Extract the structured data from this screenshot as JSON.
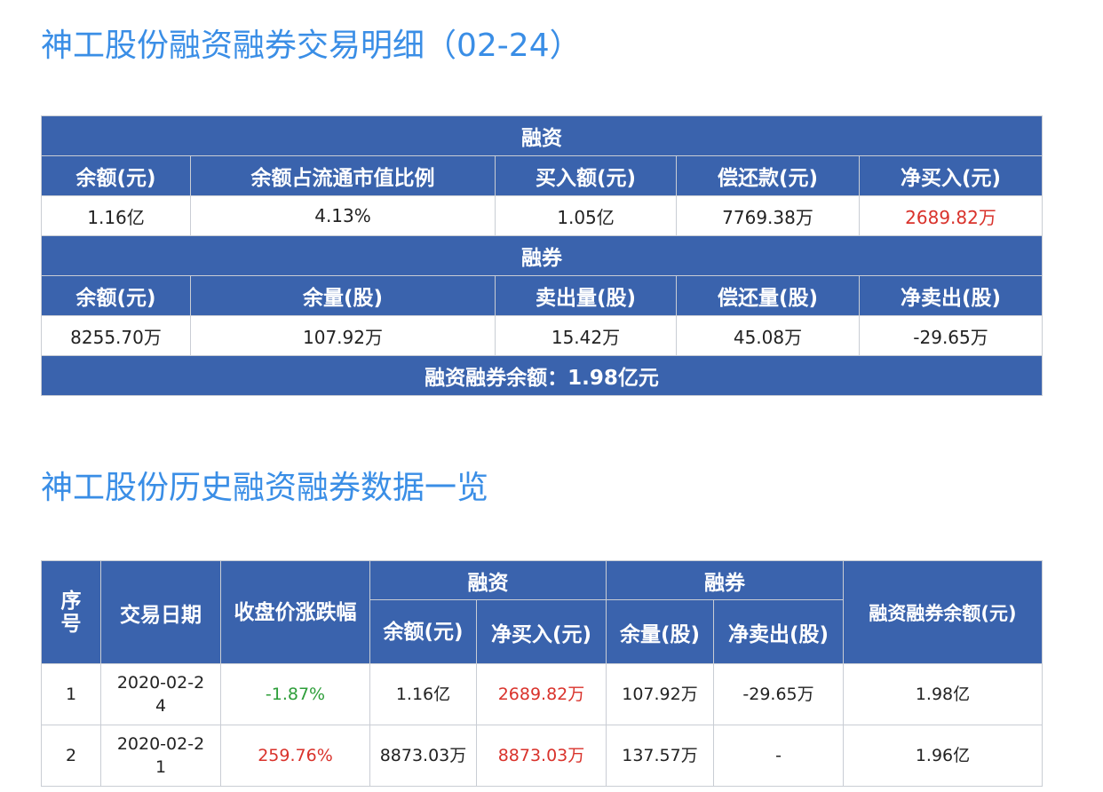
{
  "title1": "神工股份融资融券交易明细（02-24）",
  "title2": "神工股份历史融资融券数据一览",
  "summary": {
    "margin_section": "融资",
    "margin_headers": [
      "余额(元)",
      "余额占流通市值比例",
      "买入额(元)",
      "偿还款(元)",
      "净买入(元)"
    ],
    "margin_values": [
      "1.16亿",
      "4.13%",
      "1.05亿",
      "7769.38万",
      "2689.82万"
    ],
    "short_section": "融券",
    "short_headers": [
      "余额(元)",
      "余量(股)",
      "卖出量(股)",
      "偿还量(股)",
      "净卖出(股)"
    ],
    "short_values": [
      "8255.70万",
      "107.92万",
      "15.42万",
      "45.08万",
      "-29.65万"
    ],
    "total": "融资融券余额：1.98亿元"
  },
  "history": {
    "headers": {
      "index": "序号",
      "date": "交易日期",
      "change": "收盘价涨跌幅",
      "margin_group": "融资",
      "margin_balance": "余额(元)",
      "margin_net_buy": "净买入(元)",
      "short_group": "融券",
      "short_volume": "余量(股)",
      "short_net_sell": "净卖出(股)",
      "total_balance": "融资融券余额(元)"
    },
    "rows": [
      {
        "index": "1",
        "date": "2020-02-24",
        "change": "-1.87%",
        "margin_balance": "1.16亿",
        "margin_net_buy": "2689.82万",
        "short_volume": "107.92万",
        "short_net_sell": "-29.65万",
        "total_balance": "1.98亿"
      },
      {
        "index": "2",
        "date": "2020-02-21",
        "change": "259.76%",
        "margin_balance": "8873.03万",
        "margin_net_buy": "8873.03万",
        "short_volume": "137.57万",
        "short_net_sell": "-",
        "total_balance": "1.96亿"
      }
    ]
  },
  "colors": {
    "accent": "#3a8ee6",
    "header_bg": "#3a63ad",
    "positive": "#d9322b",
    "negative": "#2e9e3a"
  }
}
